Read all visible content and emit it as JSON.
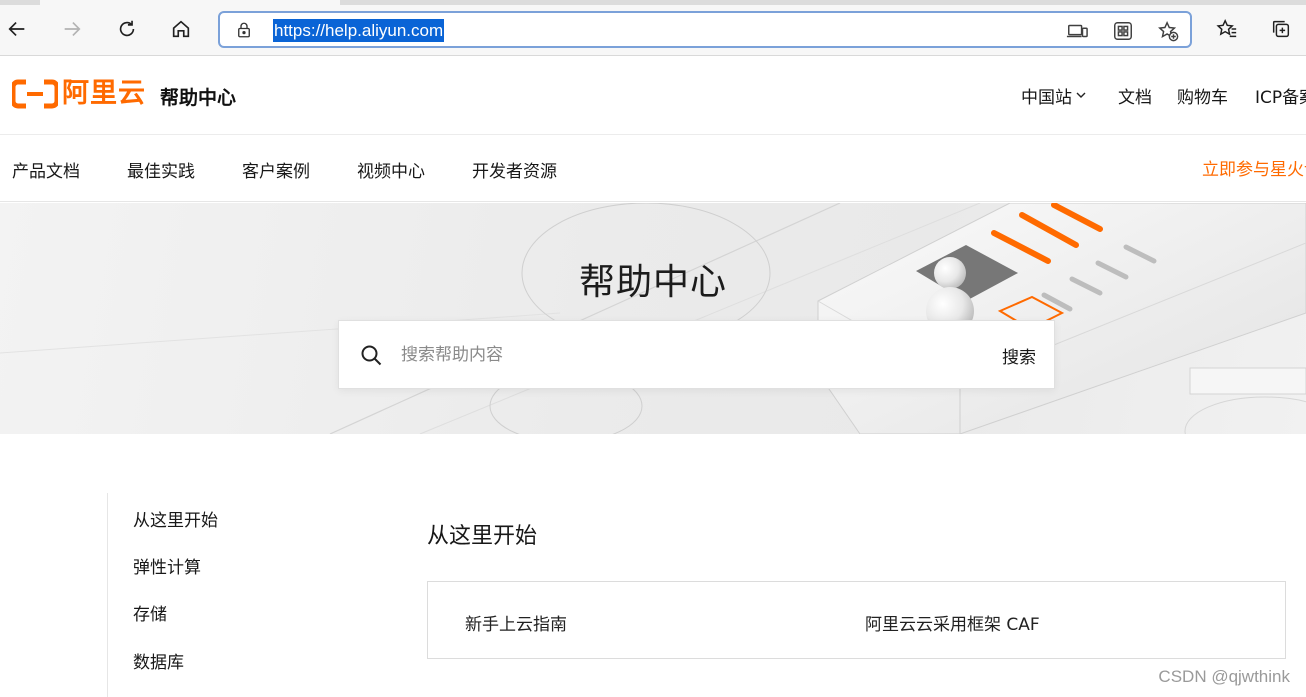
{
  "browser": {
    "url": "https://help.aliyun.com"
  },
  "header": {
    "brand": "阿里云",
    "section_title": "帮助中心",
    "nav": [
      {
        "label": "中国站"
      },
      {
        "label": "文档"
      },
      {
        "label": "购物车"
      },
      {
        "label": "ICP备案"
      }
    ]
  },
  "subnav": {
    "items": [
      "产品文档",
      "最佳实践",
      "客户案例",
      "视频中心",
      "开发者资源"
    ],
    "promo": "立即参与星火计划"
  },
  "hero": {
    "title": "帮助中心",
    "search": {
      "placeholder": "搜索帮助内容",
      "value": "",
      "button_label": "搜索"
    }
  },
  "sidebar": {
    "items": [
      "从这里开始",
      "弹性计算",
      "存储",
      "数据库"
    ]
  },
  "main": {
    "section_title": "从这里开始",
    "cards": [
      "新手上云指南",
      "阿里云云采用框架 CAF"
    ]
  },
  "watermark": "CSDN @qjwthink",
  "colors": {
    "brand_orange": "#ff6a00",
    "selection_blue": "#0a64d6",
    "address_focus": "#7ba1d9"
  }
}
